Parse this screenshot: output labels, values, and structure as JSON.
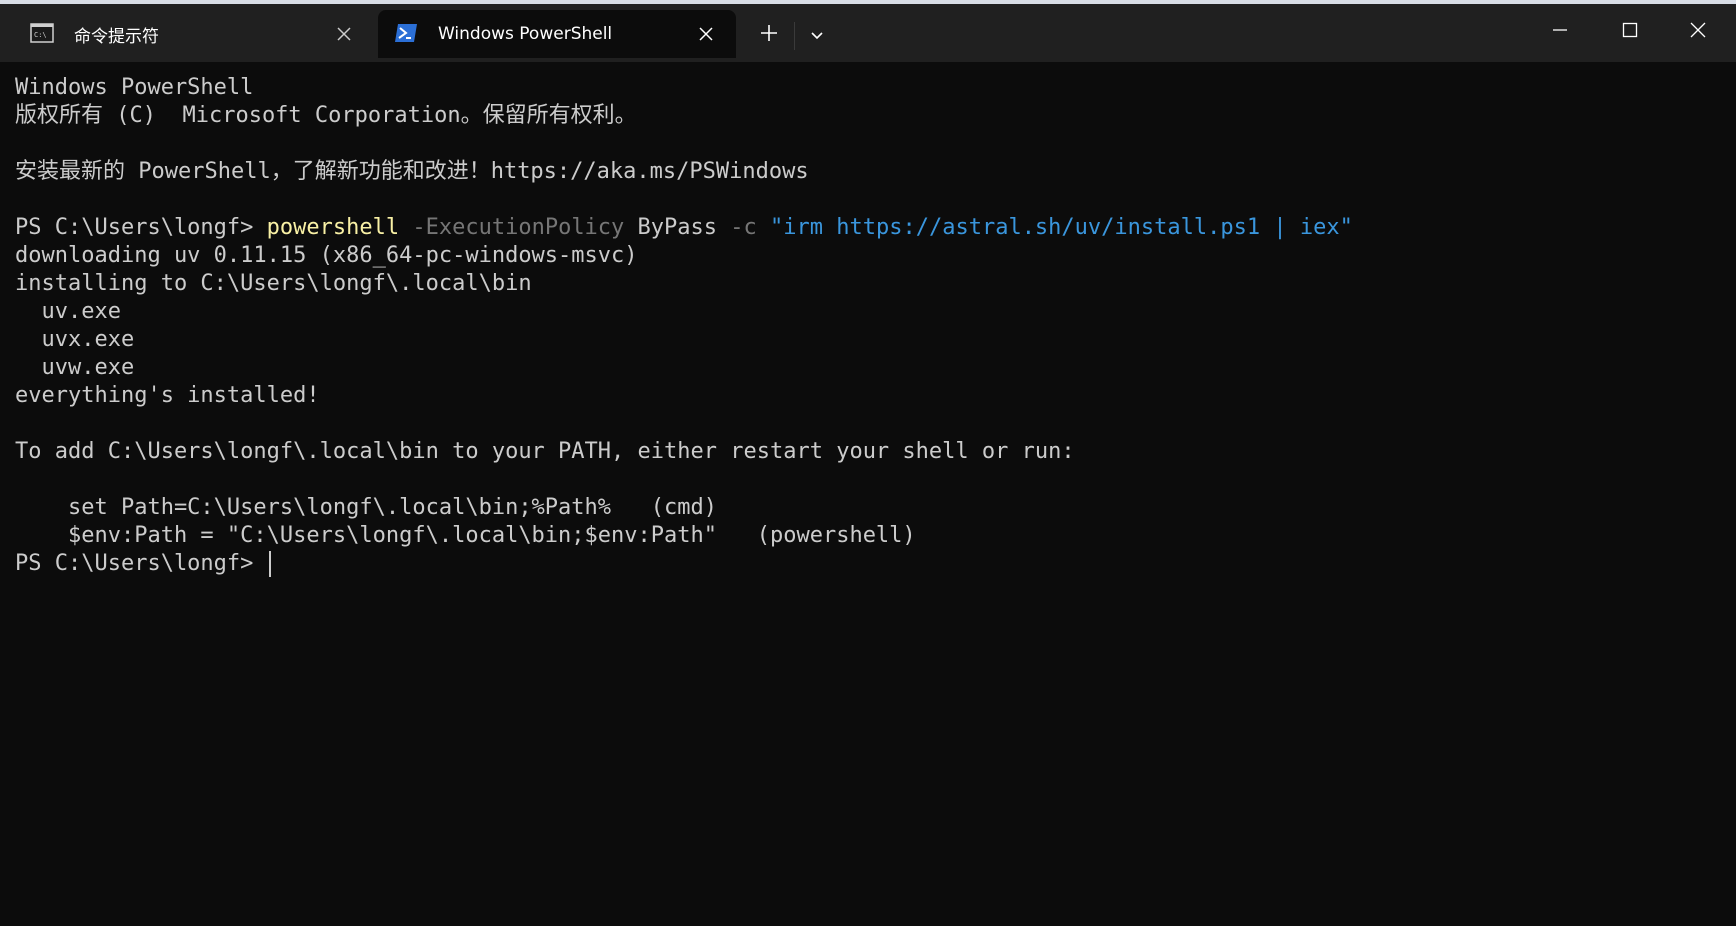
{
  "window": {
    "tabs": [
      {
        "label": "命令提示符",
        "icon": "cmd-icon",
        "active": false
      },
      {
        "label": "Windows PowerShell",
        "icon": "powershell-icon",
        "active": true
      }
    ],
    "newtab_icon": "plus-icon",
    "dropdown_icon": "chevron-down-icon",
    "controls": [
      "minimize-icon",
      "maximize-icon",
      "close-icon"
    ]
  },
  "colors": {
    "background": "#0c0c0c",
    "titlebar": "#202020",
    "text": "#cccccc",
    "command": "#f9f1a5",
    "parameter": "#767676",
    "string": "#3a96dd"
  },
  "console": {
    "header_line1": "Windows PowerShell",
    "header_line2": "版权所有 (C)  Microsoft Corporation。保留所有权利。",
    "install_msg": "安装最新的 PowerShell，了解新功能和改进！https://aka.ms/PSWindows",
    "prompt1": "PS C:\\Users\\longf> ",
    "cmd_name": "powershell",
    "cmd_param1": "-ExecutionPolicy",
    "cmd_arg1": "ByPass",
    "cmd_param2": "-c",
    "cmd_string": "\"irm https://astral.sh/uv/install.ps1 | iex\"",
    "out_downloading": "downloading uv 0.11.15 (x86_64-pc-windows-msvc)",
    "out_installing": "installing to C:\\Users\\longf\\.local\\bin",
    "out_uv": "  uv.exe",
    "out_uvx": "  uvx.exe",
    "out_uvw": "  uvw.exe",
    "out_done": "everything's installed!",
    "out_path_hint": "To add C:\\Users\\longf\\.local\\bin to your PATH, either restart your shell or run:",
    "out_set_cmd": "    set Path=C:\\Users\\longf\\.local\\bin;%Path%   (cmd)",
    "out_set_ps": "    $env:Path = \"C:\\Users\\longf\\.local\\bin;$env:Path\"   (powershell)",
    "prompt2": "PS C:\\Users\\longf> "
  }
}
